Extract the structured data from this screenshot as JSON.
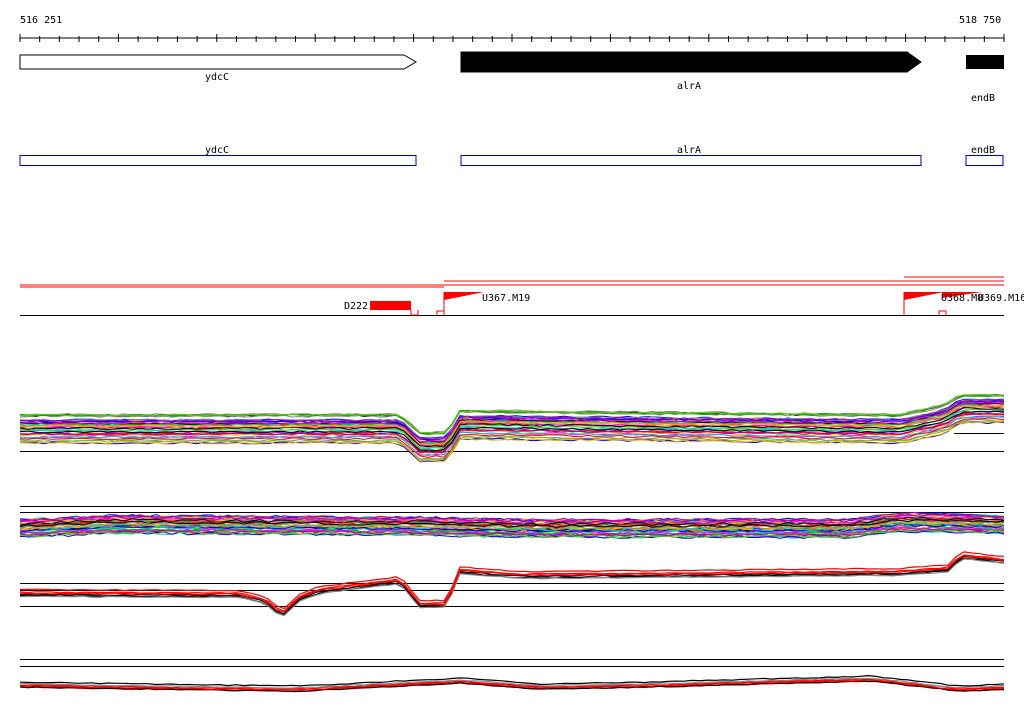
{
  "ruler": {
    "start_label": "516 251",
    "end_label": "518 750"
  },
  "genes": [
    {
      "name": "ydcC",
      "strand": "+",
      "style": "hollow"
    },
    {
      "name": "alrA",
      "strand": "+",
      "style": "filled"
    },
    {
      "name": "endB",
      "strand": "+",
      "style": "filled"
    }
  ],
  "gene_box_labels": [
    "ydcC",
    "alrA",
    "endB"
  ],
  "probes": [
    {
      "label": "D222",
      "style": "block"
    },
    {
      "label": "U367.M19",
      "style": "flag"
    },
    {
      "label": "U368.M8",
      "style": "flag"
    },
    {
      "label": "U369.M16",
      "style": "flag"
    }
  ],
  "colors": {
    "gene_box": "#0000aa",
    "probe": "#ff0000",
    "trace_palette": [
      "#ff0000",
      "#00aa00",
      "#0000ff",
      "#ff00ff",
      "#00cccc",
      "#ffaa00",
      "#888888",
      "#aa00aa",
      "#66cc00",
      "#000000"
    ]
  }
}
